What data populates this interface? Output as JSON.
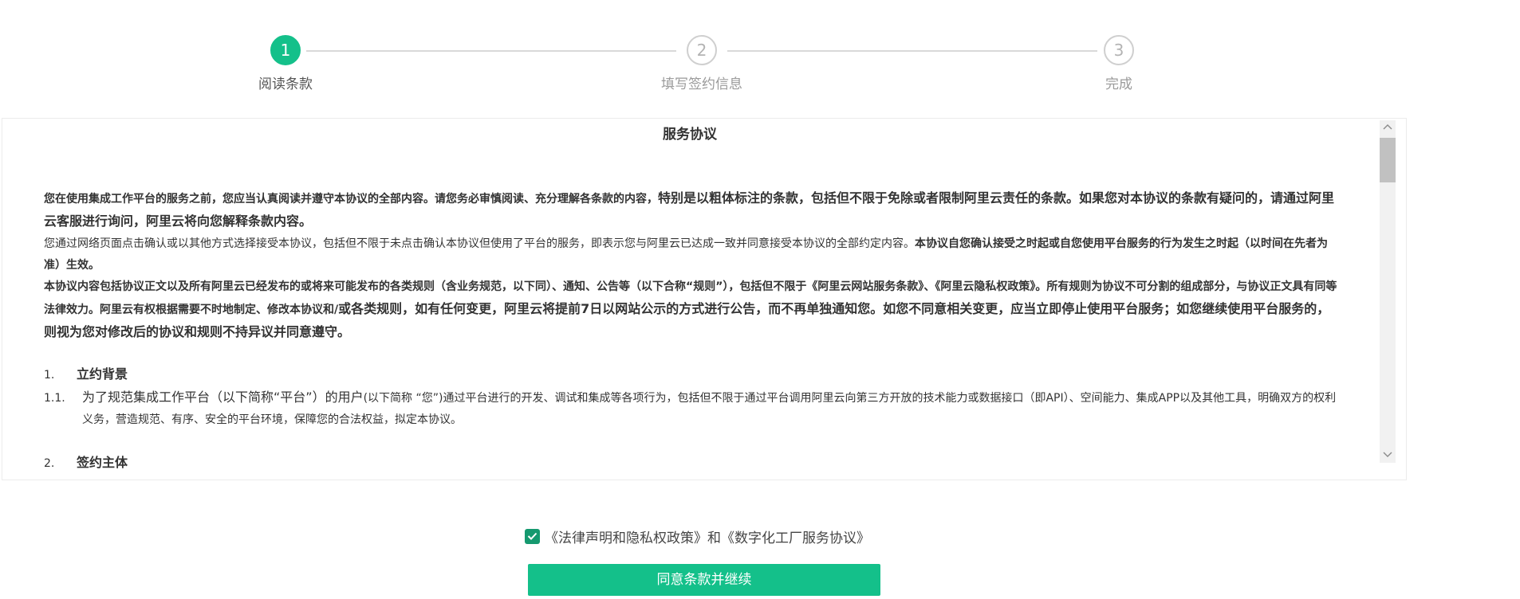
{
  "steps": [
    {
      "number": "1",
      "label": "阅读条款",
      "state": "active"
    },
    {
      "number": "2",
      "label": "填写签约信息",
      "state": "pending"
    },
    {
      "number": "3",
      "label": "完成",
      "state": "pending"
    }
  ],
  "agreement": {
    "title": "服务协议",
    "intro_p1_normal": "您在使用集成工作平台的服务之前，您应当认真阅读并遵守本协议的全部内容。请您务必审慎阅读、充分理解各条款的内容，",
    "intro_p1_bold": "特别是以粗体标注的条款，包括但不限于免除或者限制阿里云责任的条款。如果您对本协议的条款有疑问的，请通过阿里云客服进行询问，阿里云将向您解释条款内容。",
    "intro_p2_normal": "您通过网络页面点击确认或以其他方式选择接受本协议，包括但不限于未点击确认本协议但使用了平台的服务，即表示您与阿里云已达成一致并同意接受本协议的全部约定内容。",
    "intro_p2_bold": "本协议自您确认接受之时起或自您使用平台服务的行为发生之时起（以时间在先者为准）生效。",
    "intro_p3_bold_small": "本协议内容包括协议正文以及所有阿里云已经发布的或将来可能发布的各类规则（含业务规范，以下同）、通知、公告等（以下合称“规则”），包括但不限于《阿里云网站服务条款》、《阿里云隐私权政策》。所有规则为协议不可分割的组成部分，与协议正文具有同等法律效力。阿里云有权根据需要不时地制定、修改本协议和/",
    "intro_p3_bold_big": "或各类规则，如有任何变更，阿里云将提前7日以网站公示的方式进行公告，而不再单独通知您。如您不同意相关变更，应当立即停止使用平台服务；如您继续使用平台服务的，则视为您对修改后的协议和规则不持异议并同意遵守。",
    "section1_num": "1.",
    "section1_title": "立约背景",
    "section1_1_num": "1.1.",
    "section1_1_lead": "为了规范集成工作平台（以下简称“平台”）的用户",
    "section1_1_mid": "(以下简称 “您”)",
    "section1_1_rest": "通过平台进行的开发、调试和集成等各项行为，包括但不限于通过平台调用阿里云向第三方开放的技术能力或数据接口（即API）、空间能力、集成APP以及其他工具，明确双方的权利义务，营造规范、有序、安全的平台环境，保障您的合法权益，拟定本协议。",
    "section2_num": "2.",
    "section2_title": "签约主体"
  },
  "consent": {
    "checked": true,
    "text": "《法律声明和隐私权政策》和《数字化工厂服务协议》"
  },
  "agree_button": {
    "label": "同意条款并继续"
  },
  "colors": {
    "accent": "#14c08a",
    "checkbox": "#15996f",
    "inactive": "#cfcfcf"
  },
  "icons": {
    "checkbox": "check-icon",
    "scroll_up": "chevron-up-icon",
    "scroll_down": "chevron-down-icon"
  }
}
